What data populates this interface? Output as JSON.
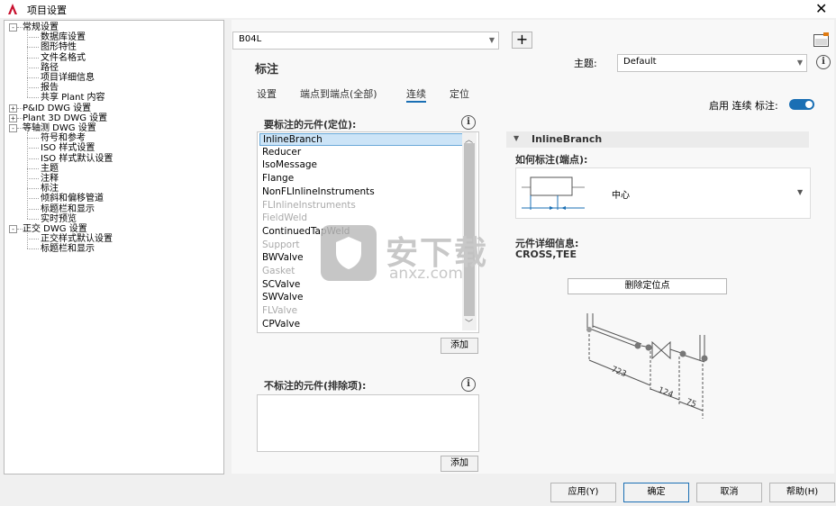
{
  "window": {
    "title": "项目设置"
  },
  "tree": [
    {
      "label": "常规设置",
      "level": 0,
      "expander": "-"
    },
    {
      "label": "数据库设置",
      "level": 1
    },
    {
      "label": "图形特性",
      "level": 1
    },
    {
      "label": "文件名格式",
      "level": 1
    },
    {
      "label": "路径",
      "level": 1
    },
    {
      "label": "项目详细信息",
      "level": 1
    },
    {
      "label": "报告",
      "level": 1
    },
    {
      "label": "共享 Plant 内容",
      "level": 1
    },
    {
      "label": "P&ID DWG 设置",
      "level": 0,
      "expander": "+"
    },
    {
      "label": "Plant 3D DWG 设置",
      "level": 0,
      "expander": "+"
    },
    {
      "label": "等轴测 DWG 设置",
      "level": 0,
      "expander": "-"
    },
    {
      "label": "符号和参考",
      "level": 1
    },
    {
      "label": "ISO 样式设置",
      "level": 1
    },
    {
      "label": "ISO 样式默认设置",
      "level": 1
    },
    {
      "label": "主题",
      "level": 1
    },
    {
      "label": "注释",
      "level": 1
    },
    {
      "label": "标注",
      "level": 1
    },
    {
      "label": "倾斜和偏移管道",
      "level": 1
    },
    {
      "label": "标题栏和显示",
      "level": 1
    },
    {
      "label": "实时预览",
      "level": 1
    },
    {
      "label": "正交 DWG 设置",
      "level": 0,
      "expander": "-"
    },
    {
      "label": "正交样式默认设置",
      "level": 1
    },
    {
      "label": "标题栏和显示",
      "level": 1
    }
  ],
  "style_select": {
    "value": "B04L"
  },
  "heading": "标注",
  "theme": {
    "label": "主题:",
    "value": "Default"
  },
  "tabs": [
    "设置",
    "端点到端点(全部)",
    "连续",
    "定位"
  ],
  "enable_toggle": {
    "label": "启用 连续 标注:",
    "on": true
  },
  "included": {
    "label": "要标注的元件(定位):",
    "items": [
      {
        "text": "InlineBranch",
        "disabled": false,
        "selected": true
      },
      {
        "text": "Reducer",
        "disabled": false
      },
      {
        "text": "IsoMessage",
        "disabled": false
      },
      {
        "text": "Flange",
        "disabled": false
      },
      {
        "text": "NonFLInlineInstruments",
        "disabled": false
      },
      {
        "text": "FLInlineInstruments",
        "disabled": true
      },
      {
        "text": "FieldWeld",
        "disabled": true
      },
      {
        "text": "ContinuedTapWeld",
        "disabled": false
      },
      {
        "text": "Support",
        "disabled": true
      },
      {
        "text": "BWValve",
        "disabled": false
      },
      {
        "text": "Gasket",
        "disabled": true
      },
      {
        "text": "SCValve",
        "disabled": false
      },
      {
        "text": "SWValve",
        "disabled": false
      },
      {
        "text": "FLValve",
        "disabled": true
      },
      {
        "text": "CPValve",
        "disabled": false
      }
    ],
    "add_label": "添加"
  },
  "excluded": {
    "label": "不标注的元件(排除项):",
    "add_label": "添加"
  },
  "detail": {
    "section_title": "InlineBranch",
    "how_label": "如何标注(端点):",
    "how_value": "中心",
    "info_label": "元件详细信息:",
    "info_value": "CROSS,TEE",
    "delete_label": "删除定位点",
    "dims": [
      "723",
      "124",
      "75"
    ]
  },
  "watermark": {
    "cn": "安下载",
    "en": "anxz.com"
  },
  "buttons": {
    "apply": "应用(Y)",
    "ok": "确定",
    "cancel": "取消",
    "help": "帮助(H)"
  },
  "colors": {
    "accent": "#1a6fb4",
    "selection": "#cce4f7",
    "app_icon": "#c8102e"
  },
  "icons": {
    "app": "autocad-logo-icon",
    "close": "close-icon",
    "add": "plus-icon",
    "style_editor": "style-editor-icon",
    "info": "info-icon"
  }
}
